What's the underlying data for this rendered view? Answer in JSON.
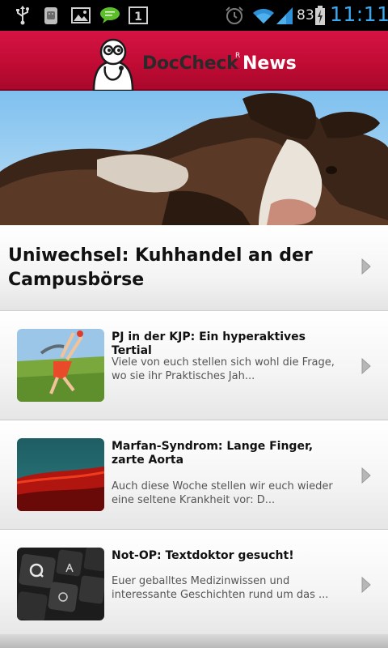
{
  "status_bar": {
    "battery_percent": "83",
    "clock": "11:11",
    "notification_badge": "1",
    "icons": [
      "usb-icon",
      "android-debug-icon",
      "gallery-icon",
      "chat-bubble-icon",
      "alarm-icon",
      "wifi-icon",
      "signal-icon",
      "battery-charging-icon"
    ]
  },
  "header": {
    "brand_main": "DocCheck",
    "brand_reg": "R",
    "brand_news": "News",
    "accent_color": "#c8103a"
  },
  "featured": {
    "title": "Uniwechsel: Kuhhandel an der Campusbörse",
    "image": "cow-photo"
  },
  "articles": [
    {
      "title": "PJ in der KJP: Ein hyperaktives Tertial",
      "teaser": "Viele von euch stellen sich wohl die Frage, wo sie ihr Praktisches Jah...",
      "thumb": "child-handstand-photo"
    },
    {
      "title": "Marfan-Syndrom: Lange Finger, zarte Aorta",
      "teaser": "Auch diese Woche stellen wir euch wieder eine seltene Krankheit vor: D...",
      "thumb": "red-wave-photo"
    },
    {
      "title": "Not-OP: Textdoktor gesucht!",
      "teaser": "Euer geballtes Medizinwissen und interessante Geschichten rund um das ...",
      "thumb": "keyboard-photo"
    }
  ]
}
